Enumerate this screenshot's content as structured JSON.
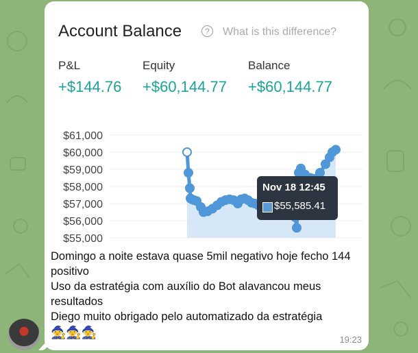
{
  "card": {
    "title": "Account Balance",
    "help_link": "What is this difference?",
    "metrics": [
      {
        "label": "P&L",
        "value": "+$144.76"
      },
      {
        "label": "Equity",
        "value": "+$60,144.77"
      },
      {
        "label": "Balance",
        "value": "+$60,144.77"
      }
    ]
  },
  "chart_data": {
    "type": "area",
    "y_ticks": [
      "$61,000",
      "$60,000",
      "$59,000",
      "$58,000",
      "$57,000",
      "$56,000",
      "$55,000"
    ],
    "ylim": [
      55000,
      61000
    ],
    "values": [
      60000,
      58800,
      57900,
      57300,
      57250,
      57200,
      57150,
      56800,
      56500,
      56550,
      56700,
      56900,
      57100,
      57200,
      57250,
      57200,
      57000,
      57250,
      57300,
      57200,
      57050,
      57000,
      56900,
      56950,
      57000,
      57100,
      57000,
      56900,
      56850,
      56950,
      57050,
      57000,
      56950,
      56900,
      56700,
      56500,
      56200,
      55585.41,
      58800,
      59050,
      58700,
      58500,
      58450,
      58800,
      59300,
      59700,
      60000,
      60144.77
    ],
    "tooltip": {
      "title": "Nov 18 12:45",
      "value": "$55,585.41"
    },
    "line_color": "#4f97d8",
    "fill_color": "#d6e8f7"
  },
  "message": {
    "lines": [
      "Domingo a noite estava quase 5mil negativo hoje fecho 144 positivo",
      "Uso da estratégia com auxílio do Bot alavancou meus resultados",
      "Diego muito obrigado pelo automatizado da estratégia"
    ],
    "emojis": "🧙🧙🧙",
    "time": "19:23"
  }
}
